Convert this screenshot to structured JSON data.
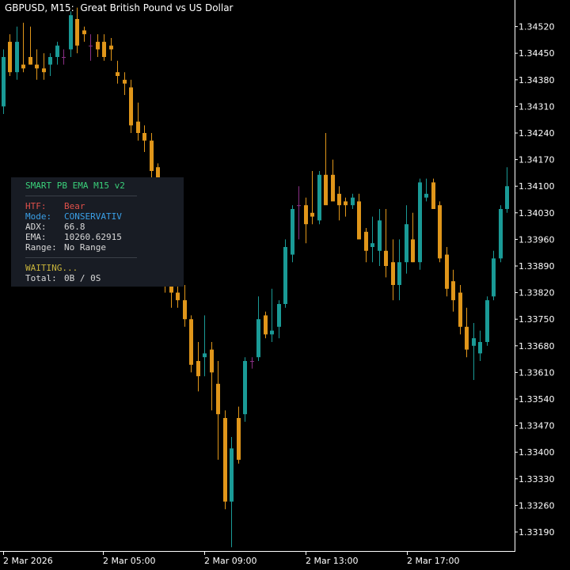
{
  "window": {
    "symbol": "GBPUSD, M15:",
    "description": "Great British Pound vs US Dollar"
  },
  "colors": {
    "background": "#000000",
    "axis": "#ffffff",
    "bull": "#1a9a96",
    "bear": "#e0961a",
    "doji": "#8a2f86",
    "panel_bg": "#181c24"
  },
  "panel": {
    "title": "SMART PB EMA M15 v2",
    "htf_label": "HTF:",
    "htf_value": "Bear",
    "mode_label": "Mode:",
    "mode_value": "CONSERVATIV",
    "adx_label": "ADX:",
    "adx_value": "66.8",
    "ema_label": "EMA:",
    "ema_value": "10260.62915",
    "range_label": "Range:",
    "range_value": "No Range",
    "status": "WAITING...",
    "total_label": "Total:",
    "total_value": "0B / 0S",
    "colors": {
      "title": "#3ad07a",
      "htf": "#e0504a",
      "mode": "#3aa0e8",
      "text": "#d8d8d8",
      "status": "#c8b43a"
    }
  },
  "chart_data": {
    "type": "candlestick",
    "y_ticks": [
      "1.34520",
      "1.34450",
      "1.34380",
      "1.34310",
      "1.34240",
      "1.34170",
      "1.34100",
      "1.34030",
      "1.33960",
      "1.33890",
      "1.33820",
      "1.33750",
      "1.33680",
      "1.33610",
      "1.33540",
      "1.33470",
      "1.33400",
      "1.33330",
      "1.33260",
      "1.33190"
    ],
    "x_ticks": [
      "2 Mar 2026",
      "2 Mar 05:00",
      "2 Mar 09:00",
      "2 Mar 13:00",
      "2 Mar 17:00"
    ],
    "ylim": [
      1.3314,
      1.3459
    ],
    "candles": [
      {
        "o": 1.3431,
        "h": 1.3446,
        "l": 1.3429,
        "c": 1.3444
      },
      {
        "o": 1.3448,
        "h": 1.345,
        "l": 1.3439,
        "c": 1.344
      },
      {
        "o": 1.344,
        "h": 1.3452,
        "l": 1.3438,
        "c": 1.3448
      },
      {
        "o": 1.3442,
        "h": 1.3453,
        "l": 1.344,
        "c": 1.3441
      },
      {
        "o": 1.3444,
        "h": 1.3452,
        "l": 1.3442,
        "c": 1.3442
      },
      {
        "o": 1.3442,
        "h": 1.3446,
        "l": 1.3438,
        "c": 1.3441
      },
      {
        "o": 1.3441,
        "h": 1.3445,
        "l": 1.3438,
        "c": 1.344
      },
      {
        "o": 1.3442,
        "h": 1.3445,
        "l": 1.3439,
        "c": 1.3444
      },
      {
        "o": 1.3444,
        "h": 1.3448,
        "l": 1.3442,
        "c": 1.3447
      },
      {
        "o": 1.3444,
        "h": 1.3446,
        "l": 1.3442,
        "c": 1.3444
      },
      {
        "o": 1.3446,
        "h": 1.3456,
        "l": 1.3444,
        "c": 1.3455
      },
      {
        "o": 1.3454,
        "h": 1.3457,
        "l": 1.3445,
        "c": 1.3447
      },
      {
        "o": 1.3451,
        "h": 1.3452,
        "l": 1.3448,
        "c": 1.345
      },
      {
        "o": 1.3447,
        "h": 1.345,
        "l": 1.3443,
        "c": 1.3447
      },
      {
        "o": 1.3448,
        "h": 1.345,
        "l": 1.3444,
        "c": 1.3446
      },
      {
        "o": 1.3448,
        "h": 1.345,
        "l": 1.3443,
        "c": 1.3444
      },
      {
        "o": 1.3447,
        "h": 1.3449,
        "l": 1.3443,
        "c": 1.3446
      },
      {
        "o": 1.344,
        "h": 1.3443,
        "l": 1.3437,
        "c": 1.3439
      },
      {
        "o": 1.3438,
        "h": 1.344,
        "l": 1.3434,
        "c": 1.3437
      },
      {
        "o": 1.3436,
        "h": 1.3438,
        "l": 1.3424,
        "c": 1.3426
      },
      {
        "o": 1.3427,
        "h": 1.3432,
        "l": 1.3422,
        "c": 1.3424
      },
      {
        "o": 1.3424,
        "h": 1.3426,
        "l": 1.3419,
        "c": 1.3422
      },
      {
        "o": 1.3422,
        "h": 1.3424,
        "l": 1.3412,
        "c": 1.3414
      },
      {
        "o": 1.3415,
        "h": 1.3416,
        "l": 1.3393,
        "c": 1.3395
      },
      {
        "o": 1.3395,
        "h": 1.3398,
        "l": 1.3382,
        "c": 1.3384
      },
      {
        "o": 1.339,
        "h": 1.3391,
        "l": 1.3378,
        "c": 1.3382
      },
      {
        "o": 1.3382,
        "h": 1.3388,
        "l": 1.3378,
        "c": 1.338
      },
      {
        "o": 1.338,
        "h": 1.3384,
        "l": 1.3373,
        "c": 1.3375
      },
      {
        "o": 1.3375,
        "h": 1.3376,
        "l": 1.3361,
        "c": 1.3363
      },
      {
        "o": 1.3364,
        "h": 1.3369,
        "l": 1.3356,
        "c": 1.336
      },
      {
        "o": 1.3365,
        "h": 1.3376,
        "l": 1.336,
        "c": 1.3366
      },
      {
        "o": 1.3367,
        "h": 1.3369,
        "l": 1.3351,
        "c": 1.3361
      },
      {
        "o": 1.3358,
        "h": 1.3364,
        "l": 1.3338,
        "c": 1.335
      },
      {
        "o": 1.3349,
        "h": 1.3351,
        "l": 1.3325,
        "c": 1.3327
      },
      {
        "o": 1.3327,
        "h": 1.3344,
        "l": 1.3315,
        "c": 1.3341
      },
      {
        "o": 1.3349,
        "h": 1.3352,
        "l": 1.3337,
        "c": 1.3338
      },
      {
        "o": 1.335,
        "h": 1.3365,
        "l": 1.3348,
        "c": 1.3364
      },
      {
        "o": 1.3364,
        "h": 1.3365,
        "l": 1.3362,
        "c": 1.3364
      },
      {
        "o": 1.3365,
        "h": 1.3381,
        "l": 1.3364,
        "c": 1.3375
      },
      {
        "o": 1.3376,
        "h": 1.3377,
        "l": 1.337,
        "c": 1.3371
      },
      {
        "o": 1.3371,
        "h": 1.3383,
        "l": 1.3369,
        "c": 1.3372
      },
      {
        "o": 1.3373,
        "h": 1.338,
        "l": 1.337,
        "c": 1.3379
      },
      {
        "o": 1.3379,
        "h": 1.3396,
        "l": 1.3378,
        "c": 1.3394
      },
      {
        "o": 1.3392,
        "h": 1.3405,
        "l": 1.339,
        "c": 1.3404
      },
      {
        "o": 1.3405,
        "h": 1.341,
        "l": 1.3396,
        "c": 1.3405
      },
      {
        "o": 1.3405,
        "h": 1.3407,
        "l": 1.3395,
        "c": 1.34
      },
      {
        "o": 1.3403,
        "h": 1.3414,
        "l": 1.34,
        "c": 1.3402
      },
      {
        "o": 1.3401,
        "h": 1.3414,
        "l": 1.34,
        "c": 1.3413
      },
      {
        "o": 1.3413,
        "h": 1.3424,
        "l": 1.341,
        "c": 1.3405
      },
      {
        "o": 1.3413,
        "h": 1.3417,
        "l": 1.341,
        "c": 1.3406
      },
      {
        "o": 1.3408,
        "h": 1.341,
        "l": 1.3401,
        "c": 1.3405
      },
      {
        "o": 1.3406,
        "h": 1.3407,
        "l": 1.3402,
        "c": 1.3405
      },
      {
        "o": 1.3405,
        "h": 1.3408,
        "l": 1.3404,
        "c": 1.3407
      },
      {
        "o": 1.3406,
        "h": 1.3408,
        "l": 1.3398,
        "c": 1.3396
      },
      {
        "o": 1.3398,
        "h": 1.3399,
        "l": 1.339,
        "c": 1.3393
      },
      {
        "o": 1.3394,
        "h": 1.3402,
        "l": 1.339,
        "c": 1.3395
      },
      {
        "o": 1.3393,
        "h": 1.3404,
        "l": 1.3389,
        "c": 1.3401
      },
      {
        "o": 1.3393,
        "h": 1.3404,
        "l": 1.3386,
        "c": 1.3389
      },
      {
        "o": 1.339,
        "h": 1.3396,
        "l": 1.338,
        "c": 1.3384
      },
      {
        "o": 1.3384,
        "h": 1.3396,
        "l": 1.338,
        "c": 1.339
      },
      {
        "o": 1.339,
        "h": 1.3405,
        "l": 1.3387,
        "c": 1.34
      },
      {
        "o": 1.3396,
        "h": 1.3403,
        "l": 1.339,
        "c": 1.339
      },
      {
        "o": 1.339,
        "h": 1.3412,
        "l": 1.3388,
        "c": 1.3411
      },
      {
        "o": 1.3407,
        "h": 1.3412,
        "l": 1.3406,
        "c": 1.3408
      },
      {
        "o": 1.3411,
        "h": 1.3412,
        "l": 1.3404,
        "c": 1.3404
      },
      {
        "o": 1.3405,
        "h": 1.3406,
        "l": 1.339,
        "c": 1.3391
      },
      {
        "o": 1.3392,
        "h": 1.3394,
        "l": 1.3381,
        "c": 1.3383
      },
      {
        "o": 1.3385,
        "h": 1.3388,
        "l": 1.3377,
        "c": 1.338
      },
      {
        "o": 1.3382,
        "h": 1.3384,
        "l": 1.3371,
        "c": 1.3373
      },
      {
        "o": 1.3373,
        "h": 1.3378,
        "l": 1.3365,
        "c": 1.3367
      },
      {
        "o": 1.3368,
        "h": 1.3374,
        "l": 1.3359,
        "c": 1.337
      },
      {
        "o": 1.3366,
        "h": 1.3372,
        "l": 1.3364,
        "c": 1.3369
      },
      {
        "o": 1.3369,
        "h": 1.3381,
        "l": 1.3368,
        "c": 1.338
      },
      {
        "o": 1.3381,
        "h": 1.3393,
        "l": 1.338,
        "c": 1.3391
      },
      {
        "o": 1.3391,
        "h": 1.3405,
        "l": 1.339,
        "c": 1.3404
      },
      {
        "o": 1.3404,
        "h": 1.3415,
        "l": 1.3403,
        "c": 1.341
      }
    ]
  }
}
